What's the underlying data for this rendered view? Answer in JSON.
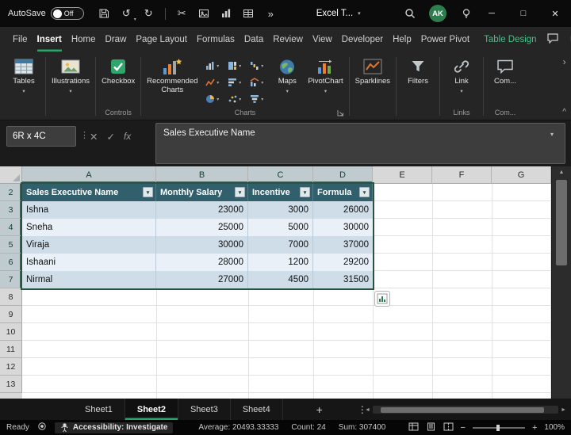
{
  "titlebar": {
    "autosave_label": "AutoSave",
    "autosave_state": "Off",
    "app_title": "Excel T...",
    "avatar_initials": "AK"
  },
  "menubar": {
    "items": [
      "File",
      "Insert",
      "Home",
      "Draw",
      "Page Layout",
      "Formulas",
      "Data",
      "Review",
      "View",
      "Developer",
      "Help",
      "Power Pivot"
    ],
    "active_item": "Insert",
    "contextual_tab": "Table Design"
  },
  "ribbon": {
    "buttons": {
      "tables": "Tables",
      "illustrations": "Illustrations",
      "checkbox": "Checkbox",
      "recommended_charts": "Recommended Charts",
      "maps": "Maps",
      "pivotchart": "PivotChart",
      "sparklines": "Sparklines",
      "filters": "Filters",
      "link": "Link",
      "comments": "Com..."
    },
    "group_labels": {
      "controls": "Controls",
      "charts": "Charts",
      "links": "Links",
      "comments": "Com..."
    },
    "chart_buttons": [
      "column-chart",
      "treemap-chart",
      "waterfall-chart",
      "line-chart",
      "bar-chart",
      "combo-chart",
      "pie-chart",
      "scatter-chart",
      "funnel-chart"
    ]
  },
  "formula_bar": {
    "name_box_value": "6R x 4C",
    "fx_label": "fx",
    "formula_value": "Sales Executive Name"
  },
  "grid": {
    "column_headers": [
      "A",
      "B",
      "C",
      "D",
      "E",
      "F",
      "G"
    ],
    "row_headers": [
      "2",
      "3",
      "4",
      "5",
      "6",
      "7",
      "8",
      "9",
      "10",
      "11",
      "12",
      "13"
    ],
    "selection": "A2:D7"
  },
  "table": {
    "headers": [
      "Sales Executive Name",
      "Monthly Salary",
      "Incentive",
      "Formula"
    ],
    "rows": [
      [
        "Ishna",
        "23000",
        "3000",
        "26000"
      ],
      [
        "Sneha",
        "25000",
        "5000",
        "30000"
      ],
      [
        "Viraja",
        "30000",
        "7000",
        "37000"
      ],
      [
        "Ishaani",
        "28000",
        "1200",
        "29200"
      ],
      [
        "Nirmal",
        "27000",
        "4500",
        "31500"
      ]
    ]
  },
  "sheet_tabs": {
    "tabs": [
      "Sheet1",
      "Sheet2",
      "Sheet3",
      "Sheet4"
    ],
    "active": "Sheet2",
    "add_label": "+"
  },
  "status_bar": {
    "mode": "Ready",
    "accessibility": "Accessibility: Investigate",
    "average": "Average: 20493.33333",
    "count": "Count: 24",
    "sum": "Sum: 307400",
    "zoom": "100%"
  },
  "colors": {
    "accent_green": "#26a56c",
    "table_header": "#31606c",
    "band_odd": "#cfdde9",
    "band_even": "#e9f0f7",
    "avatar_green": "#2e7d4f"
  },
  "icons": {
    "undo": "↺",
    "redo": "↻",
    "cut": "✂",
    "overflow": "»",
    "dropdown": "▾",
    "close": "✕",
    "maximize": "□",
    "minimize": "─",
    "more_vert": "⋮",
    "check": "✓",
    "cancel": "✕",
    "left": "◄",
    "right": "►",
    "up": "▲",
    "scroll_right": "›",
    "collapse": "^",
    "minus": "−",
    "plus": "+"
  }
}
